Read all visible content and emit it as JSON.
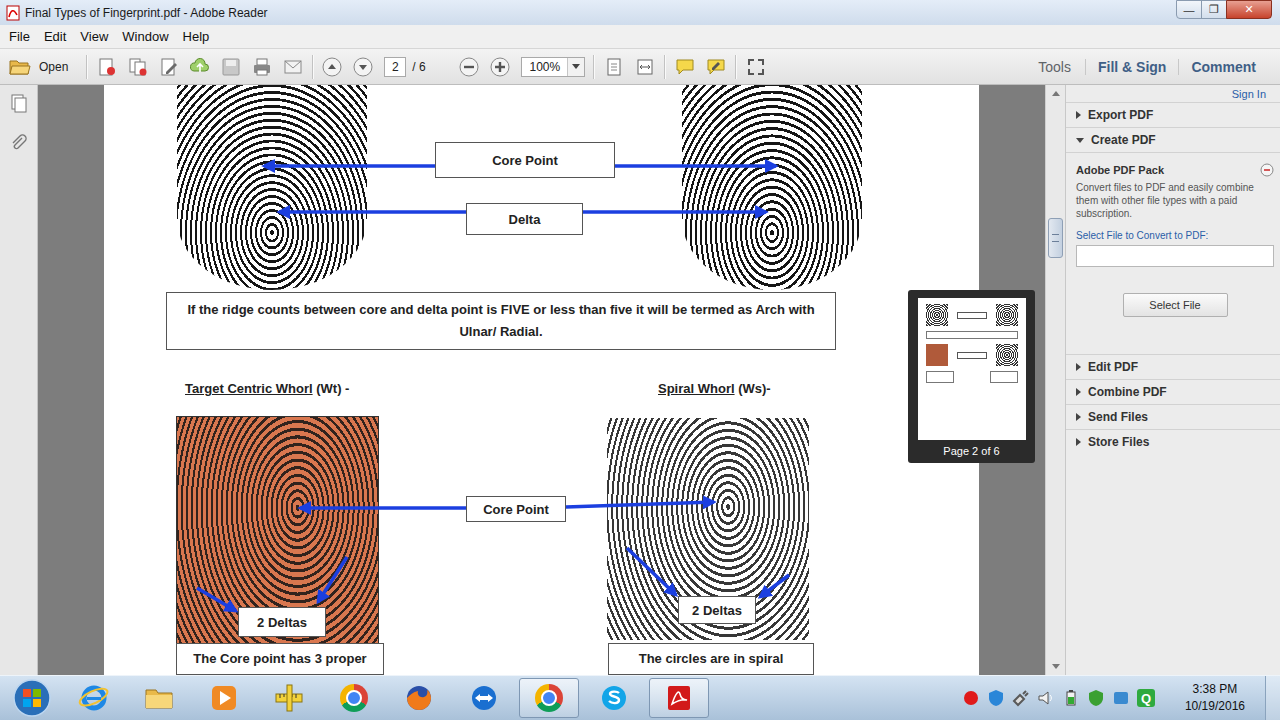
{
  "window": {
    "title": "Final Types of Fingerprint.pdf - Adobe Reader",
    "controls": [
      "—",
      "❐",
      "✕"
    ]
  },
  "menu": [
    "File",
    "Edit",
    "View",
    "Window",
    "Help"
  ],
  "toolbar": {
    "open": "Open",
    "page": "2",
    "page_total": "/ 6",
    "zoom": "100%",
    "links": [
      "Tools",
      "Fill & Sign",
      "Comment"
    ]
  },
  "document": {
    "top_labels": {
      "core": "Core Point",
      "delta": "Delta"
    },
    "note": "If the ridge counts between core and delta point is FIVE or less than five it will be termed as Arch with Ulnar/ Radial.",
    "middle_label": "Core Point",
    "whorls": [
      {
        "name": "Target Centric Whorl",
        "code": " (Wt) -",
        "deltas": "2 Deltas",
        "caption": "The Core point has 3 proper",
        "color": "#d9774f"
      },
      {
        "name": "Spiral Whorl",
        "code": " (Ws)-",
        "deltas": "2 Deltas",
        "caption": "The circles are in spiral",
        "color": "#ffffff"
      }
    ]
  },
  "thumbnail": {
    "caption": "Page 2 of 6"
  },
  "right_panel": {
    "sign_in": "Sign In",
    "sections": [
      {
        "label": "Export PDF",
        "expanded": false
      },
      {
        "label": "Create PDF",
        "expanded": true,
        "content": {
          "title": "Adobe PDF Pack",
          "description": "Convert files to PDF and easily combine them with other file types with a paid subscription.",
          "field_label": "Select File to Convert to PDF:",
          "field_value": "",
          "button": "Select File"
        }
      },
      {
        "label": "Edit PDF",
        "expanded": false
      },
      {
        "label": "Combine PDF",
        "expanded": false
      },
      {
        "label": "Send Files",
        "expanded": false
      },
      {
        "label": "Store Files",
        "expanded": false
      }
    ]
  },
  "taskbar": {
    "apps": [
      {
        "kind": "internet-explorer",
        "selected": false
      },
      {
        "kind": "file-explorer",
        "selected": false
      },
      {
        "kind": "media-player",
        "selected": false
      },
      {
        "kind": "ruler",
        "selected": false
      },
      {
        "kind": "chrome",
        "selected": false
      },
      {
        "kind": "firefox",
        "selected": false
      },
      {
        "kind": "teamviewer",
        "selected": false
      },
      {
        "kind": "chrome",
        "selected": true
      },
      {
        "kind": "skype",
        "selected": false
      },
      {
        "kind": "acrobat",
        "selected": true
      }
    ],
    "tray": [
      {
        "kind": "dot",
        "color": "#e01a1a"
      },
      {
        "kind": "shield",
        "color": "#2a86d8"
      },
      {
        "kind": "plug",
        "color": "#5a5a5a"
      },
      {
        "kind": "speaker",
        "color": "#f2f2f2"
      },
      {
        "kind": "battery",
        "color": "#f2f2f2"
      },
      {
        "kind": "shield",
        "color": "#3aa032"
      },
      {
        "kind": "box",
        "color": "#3a8ad0"
      },
      {
        "kind": "badge",
        "color": "#2faa3f",
        "label": "Q"
      }
    ],
    "time": "3:38 PM",
    "date": "10/19/2016"
  }
}
